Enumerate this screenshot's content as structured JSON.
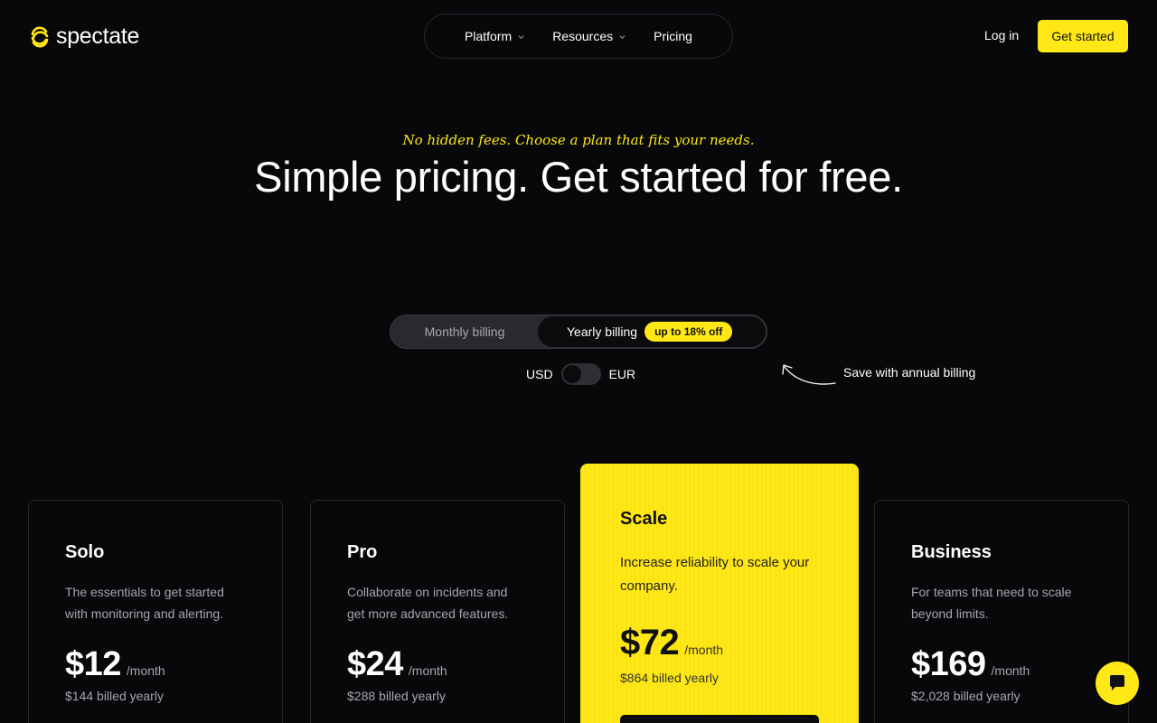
{
  "brand": {
    "name": "spectate",
    "icon": "spectate-logo-icon",
    "accent": "#ffe815"
  },
  "nav": {
    "items": [
      {
        "label": "Platform",
        "has_menu": true
      },
      {
        "label": "Resources",
        "has_menu": true
      },
      {
        "label": "Pricing",
        "has_menu": false
      }
    ],
    "login": "Log in",
    "cta": "Get started"
  },
  "hero": {
    "tagline": "No hidden fees. Choose a plan that fits your needs.",
    "headline": "Simple pricing. Get started for free."
  },
  "billing": {
    "monthly": "Monthly billing",
    "yearly": "Yearly billing",
    "discount": "up to 18% off",
    "selected": "yearly",
    "currency_left": "USD",
    "currency_right": "EUR",
    "save_note": "Save with annual billing"
  },
  "plans": [
    {
      "name": "Solo",
      "description": "The essentials to get started with monitoring and alerting.",
      "price": "$12",
      "period": "/month",
      "billed": "$144 billed yearly"
    },
    {
      "name": "Pro",
      "description": "Collaborate on incidents and get more advanced features.",
      "price": "$24",
      "period": "/month",
      "billed": "$288 billed yearly"
    },
    {
      "name": "Scale",
      "description": "Increase reliability to scale your company.",
      "price": "$72",
      "period": "/month",
      "billed": "$864 billed yearly",
      "featured": true
    },
    {
      "name": "Business",
      "description": "For teams that need to scale beyond limits.",
      "price": "$169",
      "period": "/month",
      "billed": "$2,028 billed yearly"
    }
  ],
  "chat": {
    "icon": "chat-bubble-icon"
  }
}
